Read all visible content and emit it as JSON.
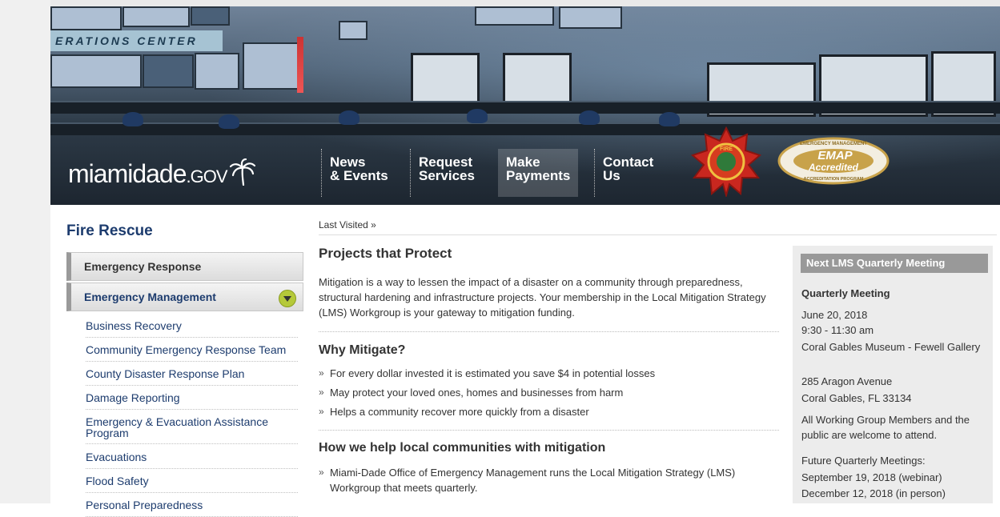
{
  "banner": {
    "sign_text": "ERATIONS CENTER",
    "logo_main": "miamidade",
    "logo_suffix": ".GOV",
    "nav": [
      {
        "line1": "News",
        "line2": "& Events"
      },
      {
        "line1": "Request",
        "line2": "Services"
      },
      {
        "line1": "Make",
        "line2": "Payments"
      },
      {
        "line1": "Contact",
        "line2": "Us"
      }
    ],
    "fire_badge_text": "FIRE",
    "emap": {
      "top": "EMERGENCY MANAGEMENT",
      "mid1": "EMAP",
      "mid2": "Accredited",
      "bottom": "ACCREDITATION PROGRAM"
    }
  },
  "sidebar": {
    "title": "Fire Rescue",
    "main_items": [
      "Emergency Response",
      "Emergency Management"
    ],
    "sub_items": [
      "Business Recovery",
      "Community Emergency Response Team",
      "County Disaster Response Plan",
      "Damage Reporting",
      "Emergency & Evacuation Assistance Program",
      "Evacuations",
      "Flood Safety",
      "Personal Preparedness"
    ]
  },
  "main": {
    "breadcrumb": "Last Visited »",
    "heading": "Projects that Protect",
    "intro": "Mitigation is a way to lessen the impact of a disaster on a community through preparedness, structural hardening and infrastructure projects. Your membership in the Local Mitigation Strategy (LMS) Workgroup is your gateway to mitigation funding.",
    "why_heading": "Why Mitigate?",
    "why_items": [
      "For every dollar invested it is estimated you save $4 in potential losses",
      "May protect your loved ones, homes and businesses from harm",
      "Helps a community recover more quickly from a disaster"
    ],
    "how_heading": "How we help local communities with mitigation",
    "how_items": [
      "Miami-Dade Office of Emergency Management runs the Local Mitigation Strategy (LMS) Workgroup that meets quarterly."
    ]
  },
  "meeting": {
    "header": "Next LMS Quarterly Meeting",
    "title": "Quarterly Meeting",
    "date": "June 20, 2018",
    "time": "9:30 - 11:30 am",
    "venue": "Coral Gables Museum - Fewell Gallery",
    "street": "285 Aragon Avenue",
    "city": "Coral Gables, FL 33134",
    "welcome": "All Working Group Members and the public are welcome to attend.",
    "future_label": "Future Quarterly Meetings:",
    "future_1": "September 19, 2018 (webinar)",
    "future_2": "December 12, 2018 (in person)"
  },
  "colors": {
    "link": "#1d3c6e",
    "toggle": "#b5c93a",
    "box_header": "#999999"
  }
}
